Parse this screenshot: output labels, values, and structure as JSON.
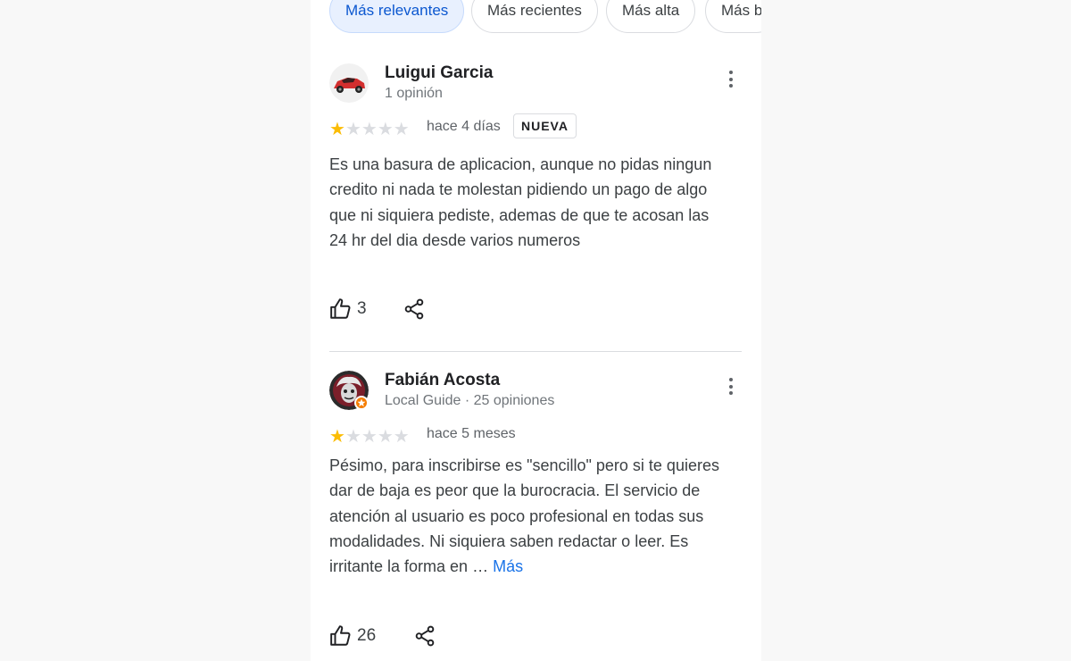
{
  "filters": [
    "Más relevantes",
    "Más recientes",
    "Más alta",
    "Más b"
  ],
  "reviews": [
    {
      "author": "Luigui Garcia",
      "meta": "1 opinión",
      "rating": 1,
      "max_rating": 5,
      "when": "hace 4 días",
      "badge": "NUEVA",
      "text": "Es una basura de aplicacion, aunque no pidas ningun credito ni nada te molestan pidiendo un pago de algo que ni siquiera pediste, ademas de que te acosan las 24 hr del dia desde varios numeros",
      "likes": "3",
      "avatar_icon": "red-car-icon"
    },
    {
      "author": "Fabián Acosta",
      "meta": "Local Guide · 25 opiniones",
      "rating": 1,
      "max_rating": 5,
      "when": "hace 5 meses",
      "text": "Pésimo, para inscribirse es \"sencillo\" pero si te quieres dar de baja es peor que la burocracia. El servicio de atención al usuario es poco profesional en todas sus modalidades. Ni siquiera saben redactar o leer. Es irritante la forma en … ",
      "more_label": "Más",
      "likes": "26",
      "avatar_icon": "einstein-avatar-icon"
    }
  ],
  "colors": {
    "star_on": "#fbbc04",
    "star_off": "#dadce0",
    "link": "#1a73e8",
    "chip_active": "#e8f0fe"
  }
}
